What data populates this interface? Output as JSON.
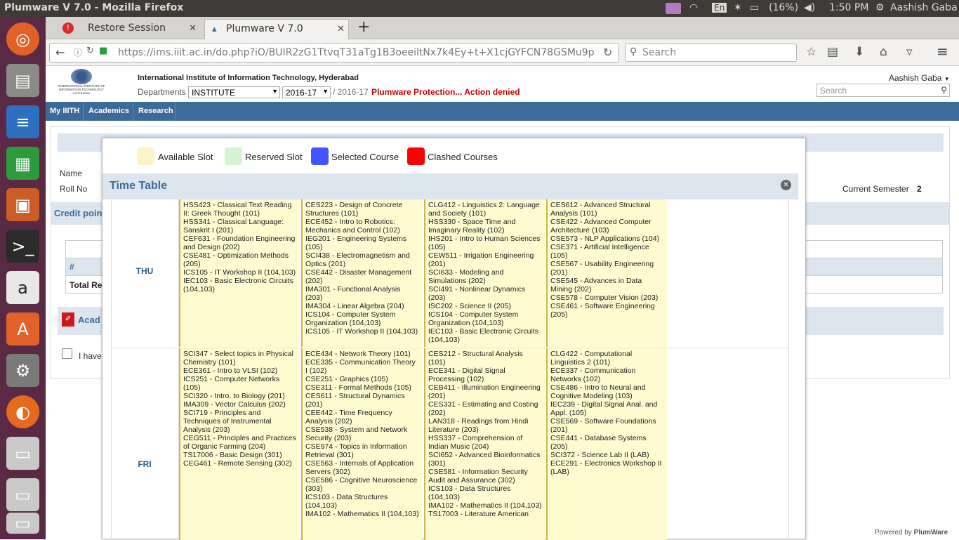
{
  "system": {
    "window_title": "Plumware V 7.0 - Mozilla Firefox",
    "keyboard": "En",
    "battery": "(16%)",
    "time": "1:50 PM",
    "user": "Aashish Gaba"
  },
  "browser": {
    "tabs": [
      {
        "label": "Restore Session"
      },
      {
        "label": "Plumware V 7.0"
      }
    ],
    "url": "https://ims.iiit.ac.in/do.php?iO/BUIR2zG1TtvqT31aTg1B3oeeiltNx7k4Ey+t+X1cjGYFCN78GSMu9p",
    "search_placeholder": "Search"
  },
  "header": {
    "institute": "International Institute of Information Technology, Hyderabad",
    "departments_label": "Departments",
    "department_value": "INSTITUTE",
    "year_value": "2016-17",
    "year_text": "/ 2016-17",
    "warning": "Plumware Protection... Action denied",
    "user": "Aashish Gaba",
    "search_placeholder": "Search",
    "logo_text": "INTERNATIONAL INSTITUTE OF INFORMATION TECHNOLOGY",
    "logo_sub": "HYDERABAD"
  },
  "menu": [
    "My IIITH",
    "Academics",
    "Research"
  ],
  "background": {
    "name_label": "Name",
    "roll_label": "Roll No",
    "current_semester_label": "Current Semester",
    "current_semester_value": "2",
    "credit_heading": "Credit poin",
    "hash": "#",
    "total": "Total Re",
    "acad": "Acad",
    "checkbox_text": "I have",
    "footer": "Powered by",
    "footer_brand": "PlumWare"
  },
  "legend": [
    {
      "label": "Available Slot",
      "color": "#fdf3c9"
    },
    {
      "label": "Reserved Slot",
      "color": "#d4f5d4"
    },
    {
      "label": "Selected Course",
      "color": "#4455ff"
    },
    {
      "label": "Clashed Courses",
      "color": "#ff0000"
    }
  ],
  "timetable_title": "Time Table",
  "days": [
    {
      "day": "THU",
      "cells": [
        [
          "HSS423 - Classical Text Reading II: Greek Thought (101)",
          "HSS341 - Classical Language: Sanskrit I (201)",
          "CEF631 - Foundation Engineering and Design (202)",
          "CSE481 - Optimization Methods (205)",
          "ICS105 - IT Workshop II (104,103)",
          "IEC103 - Basic Electronic Circuits (104,103)"
        ],
        [
          "CES223 - Design of Concrete Structures (101)",
          "ECE452 - Intro to Robotics: Mechanics and Control (102)",
          "IEG201 - Engineering Systems (105)",
          "SCI438 - Electromagnetism and Optics (201)",
          "CSE442 - Disaster Management (202)",
          "IMA301 - Functional Analysis (203)",
          "IMA304 - Linear Algebra (204)",
          "ICS104 - Computer System Organization (104,103)",
          "ICS105 - IT Workshop II (104,103)"
        ],
        [
          "CLG412 - Linguistics 2: Language and Society (101)",
          "HSS330 - Space Time and Imaginary Reality (102)",
          "IHS201 - Intro to Human Sciences (105)",
          "CEW511 - Irrigation Engineering (201)",
          "SCI633 - Modeling and Simulations (202)",
          "SCI491 - Nonlinear Dynamics (203)",
          "ISC202 - Science II (205)",
          "ICS104 - Computer System Organization (104,103)",
          "IEC103 - Basic Electronic Circuits (104,103)"
        ],
        [
          "CES612 - Advanced Structural Analysis (101)",
          "CSE422 - Advanced Computer Architecture (103)",
          "CSE573 - NLP Applications (104)",
          "CSE371 - Artificial Intelligence (105)",
          "CSE567 - Usability Engineering (201)",
          "CSE545 - Advances in Data Mining (202)",
          "CSE578 - Computer Vision (203)",
          "CSE461 - Software Engineering (205)"
        ]
      ]
    },
    {
      "day": "FRI",
      "cells": [
        [
          "SCI347 - Select topics in Physical Chemistry (101)",
          "ECE361 - Intro to VLSI (102)",
          "ICS251 - Computer Networks (105)",
          "SCI320 - Intro. to Biology (201)",
          "IMA309 - Vector Calculus (202)",
          "SCI719 - Principles and Techniques of Instrumental Analysis (203)",
          "CEG511 - Principles and Practices of Organic Farming (204)",
          "TS17006 - Basic Design (301)",
          "CEG461 - Remote Sensing (302)"
        ],
        [
          "ECE434 - Network Theory (101)",
          "ECE335 - Communication Theory I (102)",
          "CSE251 - Graphics (105)",
          "CSE311 - Formal Methods (105)",
          "CES611 - Structural Dynamics (201)",
          "CEE442 - Time Frequency Analysis (202)",
          "CSE538 - System and Network Security (203)",
          "CSE974 - Topics in Information Retrieval (301)",
          "CSE563 - Internals of Application Servers (302)",
          "CSE586 - Cognitive Neuroscience (303)",
          "ICS103 - Data Structures (104,103)",
          "IMA102 - Mathematics II (104,103)"
        ],
        [
          "CES212 - Structural Analysis (101)",
          "ECE341 - Digital Signal Processing (102)",
          "CEB411 - Illumination Engineering (201)",
          "CES331 - Estimating and Costing (202)",
          "LAN318 - Readings from Hindi Literature (203)",
          "HSS337 - Comprehension of Indian Music (204)",
          "SCI652 - Advanced Bioinformatics (301)",
          "CSE581 - Information Security Audit and Assurance (302)",
          "ICS103 - Data Structures (104,103)",
          "IMA102 - Mathematics II (104,103)",
          "TS17003 - Literature American"
        ],
        [
          "CLG422 - Computational Linguistics 2 (101)",
          "ECE337 - Communication Networks (102)",
          "CSE486 - Intro to Neural and Cognitive Modeling (103)",
          "IEC239 - Digital Signal Anal. and Appl. (105)",
          "CSE569 - Software Foundations (201)",
          "CSE441 - Database Systems (205)",
          "SCI372 - Science Lab II (LAB)",
          "ECE291 - Electronics Workshop II (LAB)"
        ]
      ]
    }
  ]
}
